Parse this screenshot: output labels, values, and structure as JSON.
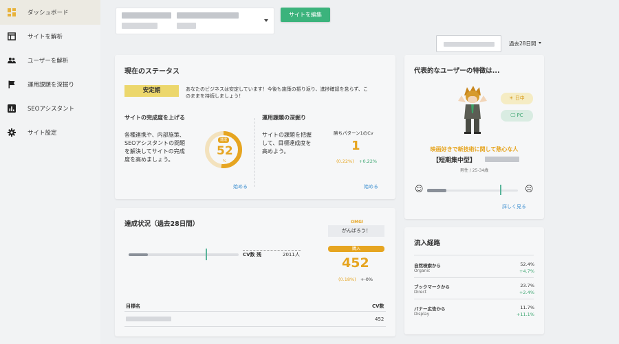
{
  "sidebar": {
    "items": [
      {
        "label": "ダッシュボード",
        "icon": "dashboard-icon"
      },
      {
        "label": "サイトを解析",
        "icon": "site-analysis-icon"
      },
      {
        "label": "ユーザーを解析",
        "icon": "users-icon"
      },
      {
        "label": "運用課題を深掘り",
        "icon": "flag-icon"
      },
      {
        "label": "SEOアシスタント",
        "icon": "bar-chart-icon"
      },
      {
        "label": "サイト設定",
        "icon": "gear-icon"
      }
    ]
  },
  "header": {
    "edit_site_label": "サイトを編集",
    "period_label": "過去28日間"
  },
  "status": {
    "title": "現在のステータス",
    "badge": "安定期",
    "message_line1": "あなたのビジネスは安定しています！今後も施策の振り返り、進捗確認を怠らず、こ",
    "message_line2": "のままを持続しましょう！",
    "completion": {
      "heading": "サイトの完成度を上げる",
      "desc": [
        "各種連携や、内部施策、",
        "SEOアシスタントの問題",
        "を解決してサイトの完成",
        "度を高めましょう。"
      ],
      "gauge_badge": "達成",
      "gauge_value": "52",
      "gauge_unit": "%",
      "gauge_fraction": 0.52,
      "start_label": "始める"
    },
    "issues": {
      "heading": "運用課題の深掘り",
      "desc": [
        "サイトの課題を把握",
        "して、目標達成度を",
        "高めよう。"
      ],
      "pattern_label": "勝ちパターン1のCv",
      "pattern_value": "1",
      "pattern_pct": "(0.22%)",
      "pattern_delta": "+0.22%",
      "start_label": "始める"
    }
  },
  "user_profile": {
    "title": "代表的なユーザーの特徴は...",
    "chip_time": "日中",
    "chip_device": "PC",
    "headline": "映画好きで新技術に関して熱心な人",
    "type_prefix": "【短期集中型】",
    "demographic": "男性 / 25-34歳",
    "slider_fraction": 0.8,
    "more_link": "詳しく見る",
    "colors": {
      "accent": "#e6a521",
      "green": "#3aa56f"
    }
  },
  "achievement": {
    "title": "達成状況（過去28日間）",
    "cv_remaining_label": "CV数 残",
    "cv_remaining_value": "2011人",
    "progress_fraction": 0.7,
    "omg": "OMG!",
    "cheer": "がんばろう！",
    "purchase_label": "購入",
    "purchase_value": "452",
    "purchase_pct": "(0.18%)",
    "purchase_delta": "+-0%",
    "table": {
      "col_goal": "目標名",
      "col_cv": "CV数",
      "rows": [
        {
          "cv": "452"
        }
      ]
    }
  },
  "traffic": {
    "title": "流入経路",
    "rows": [
      {
        "name": "自然検索から",
        "sub": "Organic",
        "pct": "52.4%",
        "delta": "+4.7%"
      },
      {
        "name": "ブックマークから",
        "sub": "Direct",
        "pct": "23.7%",
        "delta": "+2.4%"
      },
      {
        "name": "バナー広告から",
        "sub": "Display",
        "pct": "11.7%",
        "delta": "+11.1%"
      }
    ]
  }
}
